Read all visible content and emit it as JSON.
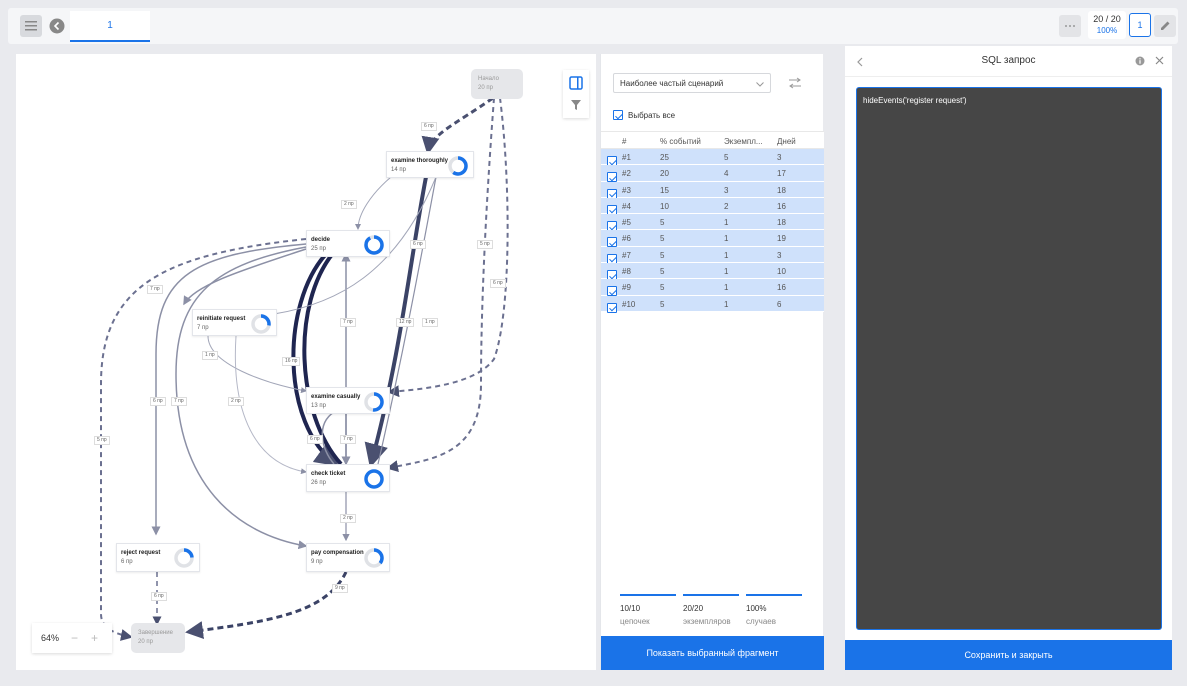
{
  "topbar": {
    "tab_label": "1",
    "counter": "20 / 20",
    "counter_pct": "100%",
    "page": "1"
  },
  "canvas": {
    "nodes": {
      "start": {
        "name": "Начало",
        "count": "20 пр"
      },
      "examine_thoroughly": {
        "name": "examine thoroughly",
        "count": "14 пр"
      },
      "decide": {
        "name": "decide",
        "count": "25 пр"
      },
      "reinitiate": {
        "name": "reinitiate request",
        "count": "7 пр"
      },
      "examine_casually": {
        "name": "examine casually",
        "count": "13 пр"
      },
      "check_ticket": {
        "name": "check ticket",
        "count": "26 пр"
      },
      "reject": {
        "name": "reject request",
        "count": "6 пр"
      },
      "pay": {
        "name": "pay compensation",
        "count": "9 пр"
      },
      "end": {
        "name": "Завершение",
        "count": "20 пр"
      }
    },
    "edge_labels": [
      "6 пр",
      "2 пр",
      "6 пр",
      "5 пр",
      "6 пр",
      "7 пр",
      "7 пр",
      "12 пр",
      "1 пр",
      "16 пр",
      "1 пр",
      "6 пр",
      "7 пр",
      "2 пр",
      "6 пр",
      "7 пр",
      "5 пр",
      "2 пр",
      "6 пр",
      "9 пр"
    ],
    "zoom": "64%"
  },
  "scenario": {
    "select_value": "Наиболее частый сценарий",
    "select_all": "Выбрать все",
    "headers": [
      "#",
      "% событий",
      "Экземпл...",
      "Дней"
    ],
    "rows": [
      [
        "#1",
        "25",
        "5",
        "3"
      ],
      [
        "#2",
        "20",
        "4",
        "17"
      ],
      [
        "#3",
        "15",
        "3",
        "18"
      ],
      [
        "#4",
        "10",
        "2",
        "16"
      ],
      [
        "#5",
        "5",
        "1",
        "18"
      ],
      [
        "#6",
        "5",
        "1",
        "19"
      ],
      [
        "#7",
        "5",
        "1",
        "3"
      ],
      [
        "#8",
        "5",
        "1",
        "10"
      ],
      [
        "#9",
        "5",
        "1",
        "16"
      ],
      [
        "#10",
        "5",
        "1",
        "6"
      ]
    ],
    "stats": [
      {
        "value": "10/10",
        "label": "цепочек"
      },
      {
        "value": "20/20",
        "label": "экземпляров"
      },
      {
        "value": "100%",
        "label": "случаев"
      }
    ],
    "show_button": "Показать выбранный фрагмент"
  },
  "sql_panel": {
    "title": "SQL запрос",
    "code": "hideEvents('register request')",
    "save_button": "Сохранить и закрыть"
  },
  "colors": {
    "accent": "#1a73e8",
    "row_highlight": "#cfe1fb",
    "code_bg": "#464646"
  }
}
